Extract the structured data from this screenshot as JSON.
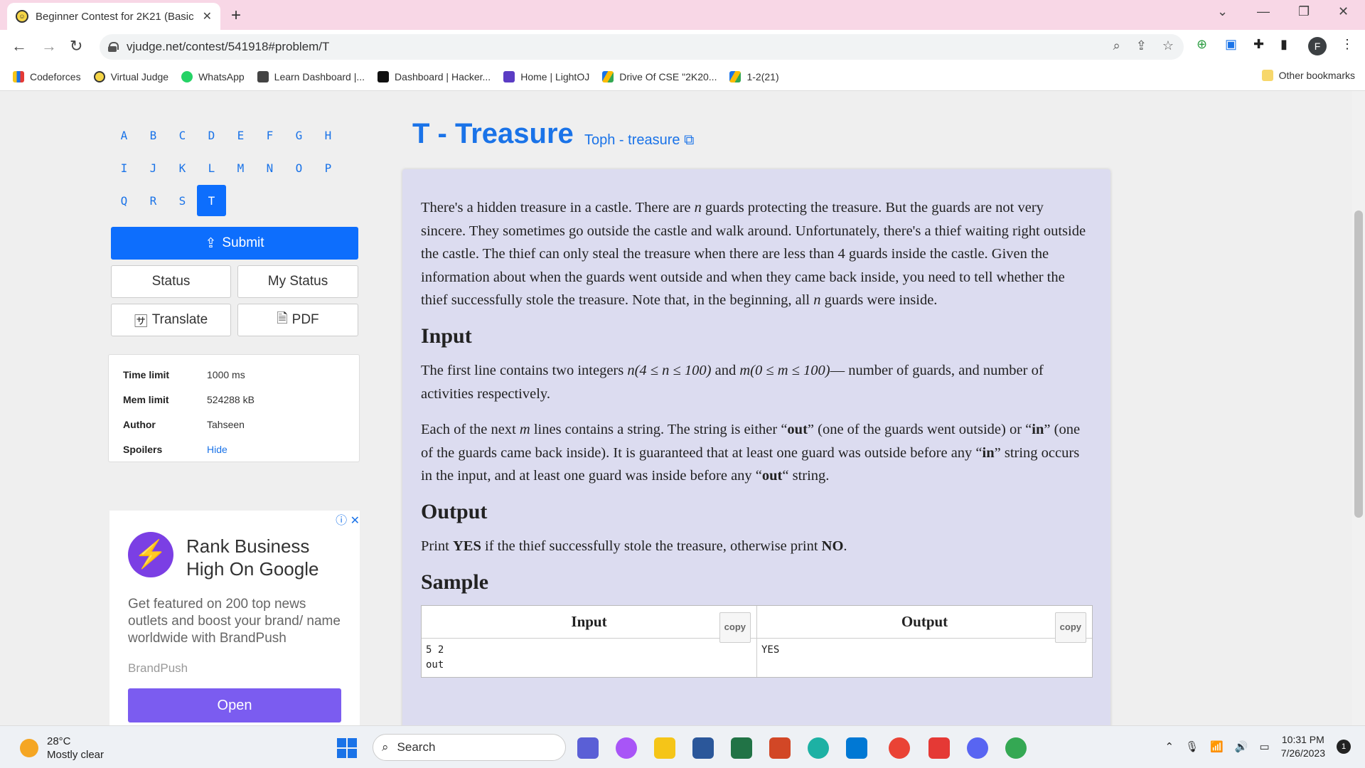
{
  "browser": {
    "tab_title": "Beginner Contest for 2K21 (Basic",
    "url": "vjudge.net/contest/541918#problem/T",
    "bookmarks": [
      "Codeforces",
      "Virtual Judge",
      "WhatsApp",
      "Learn Dashboard |...",
      "Dashboard | Hacker...",
      "Home | LightOJ",
      "Drive Of CSE \"2K20...",
      "1-2(21)"
    ],
    "other_bookmarks": "Other bookmarks",
    "avatar": "F"
  },
  "problem_nav": {
    "rows": [
      [
        "A",
        "B",
        "C",
        "D",
        "E",
        "F",
        "G",
        "H"
      ],
      [
        "I",
        "J",
        "K",
        "L",
        "M",
        "N",
        "O",
        "P"
      ],
      [
        "Q",
        "R",
        "S",
        "T"
      ]
    ],
    "active": "T"
  },
  "actions": {
    "submit": "Submit",
    "status": "Status",
    "my_status": "My Status",
    "translate": "Translate",
    "pdf": "PDF"
  },
  "info": {
    "time_limit_label": "Time limit",
    "time_limit": "1000 ms",
    "mem_limit_label": "Mem limit",
    "mem_limit": "524288 kB",
    "author_label": "Author",
    "author": "Tahseen",
    "spoilers_label": "Spoilers",
    "spoilers": "Hide"
  },
  "ad": {
    "title": "Rank Business High On Google",
    "body": "Get featured on 200 top news outlets and boost your brand/ name worldwide with BrandPush",
    "brand": "BrandPush",
    "cta": "Open",
    "close": "ⓘ ✕"
  },
  "problem": {
    "title": "T - Treasure",
    "origin": "Toph - treasure",
    "statement_1": "There's a hidden treasure in a castle. There are ",
    "statement_n": "n",
    "statement_2": " guards protecting the treasure. But the guards are not very sincere. They sometimes go outside the castle and walk around. Unfortunately, there's a thief waiting right outside the castle. The thief can only steal the treasure when there are less than 4 guards inside the castle. Given the information about when the guards went outside and when they came back inside, you need to tell whether the thief successfully stole the treasure. Note that, in the beginning, all ",
    "statement_3": " guards were inside.",
    "input_heading": "Input",
    "input_1a": "The first line contains two integers ",
    "input_1b": "n(4 ≤ n ≤ 100)",
    "input_1c": " and ",
    "input_1d": "m(0 ≤ m ≤ 100)",
    "input_1e": "— number of guards, and number of activities respectively.",
    "input_2a": "Each of the next ",
    "input_2b": "m",
    "input_2c": " lines contains a string. The string is either “",
    "input_2d": "out",
    "input_2e": "” (one of the guards went outside) or “",
    "input_2f": "in",
    "input_2g": "” (one of the guards came back inside). It is guaranteed that at least one guard was outside before any “",
    "input_2h": "in",
    "input_2i": "” string occurs in the input, and at least one guard was inside before any “",
    "input_2j": "out",
    "input_2k": "“ string.",
    "output_heading": "Output",
    "output_a": "Print ",
    "output_yes": "YES",
    "output_b": " if the thief successfully stole the treasure, otherwise print ",
    "output_no": "NO",
    "output_c": ".",
    "sample_heading": "Sample",
    "sample_input_header": "Input",
    "sample_output_header": "Output",
    "copy": "copy",
    "sample_input": "5 2\nout",
    "sample_output": "YES"
  },
  "taskbar": {
    "temp": "28°C",
    "weather": "Mostly clear",
    "search": "Search",
    "time": "10:31 PM",
    "date": "7/26/2023",
    "notif": "1"
  }
}
